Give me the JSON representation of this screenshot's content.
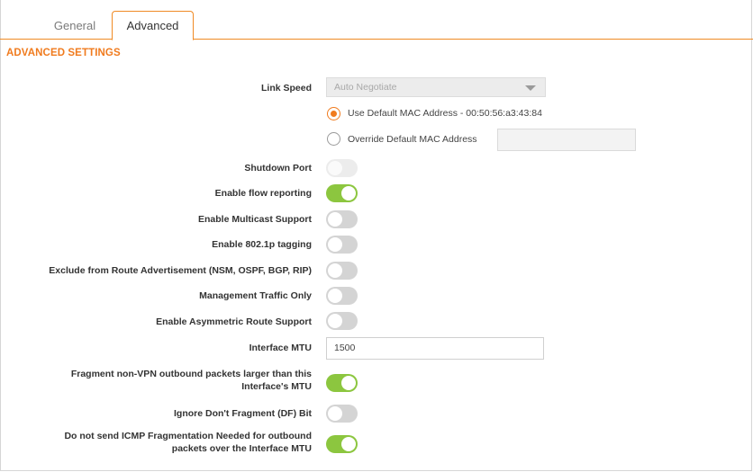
{
  "tabs": [
    {
      "label": "General"
    },
    {
      "label": "Advanced"
    }
  ],
  "section_title": "ADVANCED SETTINGS",
  "link_speed": {
    "label": "Link Speed",
    "value": "Auto Negotiate"
  },
  "mac": {
    "use_default_label": "Use Default MAC Address - 00:50:56:a3:43:84",
    "override_label": "Override Default MAC Address",
    "override_value": ""
  },
  "settings": {
    "shutdown_port": {
      "label": "Shutdown Port",
      "state": "off-disabled"
    },
    "flow_reporting": {
      "label": "Enable flow reporting",
      "state": "on"
    },
    "multicast": {
      "label": "Enable Multicast Support",
      "state": "off"
    },
    "tagging_8021p": {
      "label": "Enable 802.1p tagging",
      "state": "off"
    },
    "exclude_route_adv": {
      "label": "Exclude from Route Advertisement (NSM, OSPF, BGP, RIP)",
      "state": "off"
    },
    "mgmt_traffic_only": {
      "label": "Management Traffic Only",
      "state": "off"
    },
    "asym_route": {
      "label": "Enable Asymmetric Route Support",
      "state": "off"
    },
    "fragment_non_vpn_line1": "Fragment non-VPN outbound packets larger than this",
    "fragment_non_vpn_line2": "Interface's MTU",
    "fragment_non_vpn_state": "on",
    "ignore_df": {
      "label": "Ignore Don't Fragment (DF) Bit",
      "state": "off"
    },
    "no_icmp_line1": "Do not send ICMP Fragmentation Needed for outbound",
    "no_icmp_line2": "packets over the Interface MTU",
    "no_icmp_state": "on"
  },
  "interface_mtu": {
    "label": "Interface MTU",
    "value": "1500"
  },
  "colors": {
    "accent": "#f07b1e",
    "toggle_on": "#8cc63f",
    "toggle_off": "#d4d4d4"
  }
}
